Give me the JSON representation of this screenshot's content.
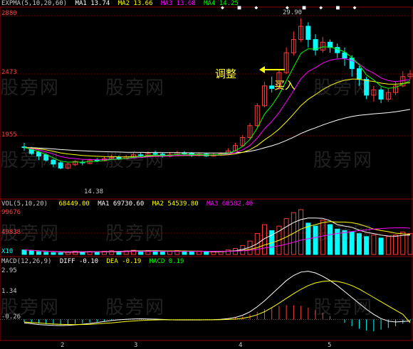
{
  "chart_data": [
    {
      "type": "candlestick",
      "header": {
        "label": "EXPMA(5,10,20,60)",
        "ma1": "MA1 13.74",
        "ma2": "MA2 13.66",
        "ma3": "MA3 13.68",
        "ma4": "MA4 14.25"
      },
      "y_ticks": [
        "2880",
        "2473",
        "1955"
      ],
      "y_range": [
        1550,
        2880
      ],
      "annotations": {
        "high": "29.90",
        "low": "14.38"
      },
      "candles": [
        [
          1890,
          1885,
          1920,
          1860
        ],
        [
          1880,
          1840,
          1890,
          1830
        ],
        [
          1850,
          1820,
          1860,
          1790
        ],
        [
          1830,
          1790,
          1840,
          1780
        ],
        [
          1790,
          1760,
          1800,
          1740
        ],
        [
          1770,
          1730,
          1780,
          1720
        ],
        [
          1730,
          1760,
          1770,
          1720
        ],
        [
          1755,
          1780,
          1790,
          1745
        ],
        [
          1775,
          1770,
          1790,
          1750
        ],
        [
          1765,
          1790,
          1800,
          1760
        ],
        [
          1790,
          1785,
          1805,
          1775
        ],
        [
          1785,
          1800,
          1815,
          1780
        ],
        [
          1800,
          1810,
          1830,
          1795
        ],
        [
          1810,
          1800,
          1825,
          1790
        ],
        [
          1800,
          1815,
          1830,
          1795
        ],
        [
          1815,
          1830,
          1845,
          1805
        ],
        [
          1830,
          1825,
          1850,
          1815
        ],
        [
          1825,
          1840,
          1855,
          1820
        ],
        [
          1840,
          1835,
          1860,
          1825
        ],
        [
          1835,
          1820,
          1845,
          1810
        ],
        [
          1820,
          1830,
          1845,
          1812
        ],
        [
          1830,
          1845,
          1860,
          1825
        ],
        [
          1845,
          1840,
          1858,
          1830
        ],
        [
          1840,
          1825,
          1850,
          1815
        ],
        [
          1825,
          1835,
          1848,
          1818
        ],
        [
          1835,
          1822,
          1845,
          1815
        ],
        [
          1822,
          1830,
          1842,
          1815
        ],
        [
          1830,
          1838,
          1850,
          1822
        ],
        [
          1838,
          1860,
          1880,
          1830
        ],
        [
          1860,
          1900,
          1920,
          1855
        ],
        [
          1900,
          1960,
          1980,
          1890
        ],
        [
          1960,
          2050,
          2070,
          1950
        ],
        [
          2050,
          2200,
          2220,
          2040
        ],
        [
          2200,
          2350,
          2380,
          2190
        ],
        [
          2350,
          2330,
          2420,
          2300
        ],
        [
          2330,
          2450,
          2470,
          2320
        ],
        [
          2450,
          2600,
          2640,
          2440
        ],
        [
          2600,
          2700,
          2760,
          2580
        ],
        [
          2700,
          2800,
          2860,
          2680
        ],
        [
          2800,
          2700,
          2830,
          2640
        ],
        [
          2700,
          2620,
          2740,
          2580
        ],
        [
          2620,
          2680,
          2720,
          2600
        ],
        [
          2680,
          2640,
          2700,
          2600
        ],
        [
          2640,
          2600,
          2670,
          2560
        ],
        [
          2600,
          2560,
          2640,
          2500
        ],
        [
          2560,
          2480,
          2580,
          2420
        ],
        [
          2480,
          2400,
          2500,
          2350
        ],
        [
          2400,
          2280,
          2420,
          2250
        ],
        [
          2280,
          2320,
          2350,
          2230
        ],
        [
          2320,
          2250,
          2340,
          2220
        ],
        [
          2250,
          2300,
          2330,
          2230
        ],
        [
          2300,
          2350,
          2380,
          2280
        ],
        [
          2350,
          2420,
          2460,
          2340
        ],
        [
          2420,
          2440,
          2470,
          2400
        ]
      ],
      "ema_colors": [
        "#ffffff",
        "#ffff00",
        "#ff00ff",
        "#00ff00"
      ]
    },
    {
      "type": "bar",
      "header": {
        "label": "VOL(5,10,20)",
        "v1": "68449.00",
        "ma1": "MA1 69730.60",
        "ma2": "MA2 54539.80",
        "ma3": "MA3 68582.40"
      },
      "y_ticks": [
        "99676",
        "49838",
        "X10"
      ],
      "values": [
        30,
        25,
        18,
        15,
        12,
        10,
        18,
        22,
        16,
        20,
        18,
        22,
        25,
        20,
        24,
        28,
        22,
        26,
        24,
        18,
        22,
        26,
        22,
        18,
        20,
        16,
        18,
        22,
        30,
        40,
        60,
        90,
        140,
        200,
        160,
        190,
        240,
        280,
        300,
        210,
        190,
        230,
        200,
        170,
        160,
        150,
        140,
        120,
        130,
        110,
        120,
        130,
        150,
        140
      ],
      "up_color": "#ff3b3b",
      "down_color": "#00ffff"
    },
    {
      "type": "bar",
      "header": {
        "label": "MACD(12,26,9)",
        "diff": "DIFF -0.10",
        "dea": "DEA -0.19",
        "macd": "MACD 0.19"
      },
      "y_ticks": [
        "2.95",
        "1.34",
        "-0.26"
      ],
      "y_range": [
        -1.2,
        3.0
      ],
      "values": [
        -0.15,
        -0.2,
        -0.25,
        -0.28,
        -0.3,
        -0.32,
        -0.3,
        -0.26,
        -0.22,
        -0.18,
        -0.14,
        -0.1,
        -0.06,
        -0.04,
        -0.02,
        -0.01,
        0.0,
        -0.02,
        -0.03,
        -0.04,
        -0.05,
        -0.04,
        -0.03,
        -0.02,
        -0.02,
        -0.01,
        0.0,
        0.02,
        0.05,
        0.1,
        0.18,
        0.3,
        0.45,
        0.6,
        0.72,
        0.8,
        0.85,
        0.84,
        0.8,
        0.7,
        0.55,
        0.4,
        0.2,
        0.0,
        -0.2,
        -0.4,
        -0.55,
        -0.65,
        -0.7,
        -0.6,
        -0.5,
        -0.4,
        -0.25,
        -0.1
      ],
      "diff": [
        -0.2,
        -0.25,
        -0.3,
        -0.33,
        -0.35,
        -0.36,
        -0.35,
        -0.32,
        -0.28,
        -0.24,
        -0.18,
        -0.12,
        -0.06,
        -0.02,
        0.01,
        0.03,
        0.04,
        0.03,
        0.02,
        0.0,
        -0.02,
        -0.03,
        -0.03,
        -0.03,
        -0.03,
        -0.02,
        -0.01,
        0.01,
        0.05,
        0.12,
        0.25,
        0.45,
        0.75,
        1.1,
        1.5,
        1.9,
        2.3,
        2.6,
        2.8,
        2.85,
        2.75,
        2.55,
        2.3,
        2.0,
        1.65,
        1.3,
        0.95,
        0.6,
        0.3,
        0.05,
        -0.1,
        -0.15,
        -0.12,
        -0.1
      ],
      "dea": [
        -0.15,
        -0.18,
        -0.21,
        -0.24,
        -0.27,
        -0.29,
        -0.3,
        -0.3,
        -0.3,
        -0.29,
        -0.26,
        -0.23,
        -0.2,
        -0.16,
        -0.12,
        -0.09,
        -0.06,
        -0.04,
        -0.03,
        -0.02,
        -0.02,
        -0.02,
        -0.02,
        -0.02,
        -0.02,
        -0.02,
        -0.02,
        -0.01,
        0.0,
        0.02,
        0.07,
        0.15,
        0.28,
        0.46,
        0.7,
        0.96,
        1.25,
        1.52,
        1.78,
        2.0,
        2.16,
        2.25,
        2.28,
        2.25,
        2.15,
        2.0,
        1.8,
        1.55,
        1.3,
        1.05,
        0.8,
        0.55,
        0.3,
        -0.19
      ]
    }
  ],
  "x_ticks": [
    "2",
    "3",
    "4",
    "5"
  ],
  "watermark": "股旁网",
  "labels": {
    "adjust": "调整",
    "buy": "买入"
  },
  "top_markers": [
    "◆",
    "■",
    "◆",
    "◆",
    "■",
    "◆",
    "■",
    "◆"
  ]
}
